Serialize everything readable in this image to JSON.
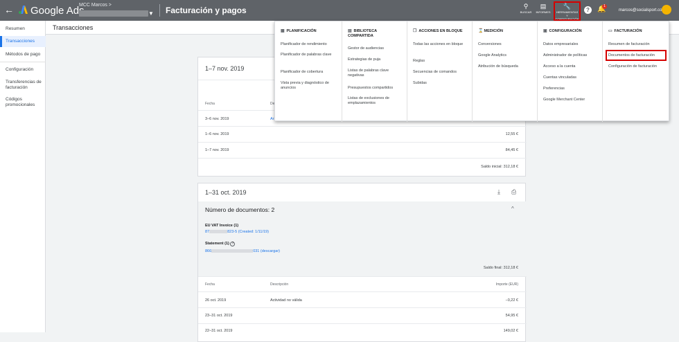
{
  "topbar": {
    "back_icon": "arrow-left",
    "brand": "Google Ads",
    "account_label": "MCC Marcos  >",
    "page_title": "Facturación y pagos",
    "search_label": "BUSCAR",
    "reports_label": "INFORMES",
    "tools_label": "HERRAMIENTAS Y CONFIGURACIÓN",
    "help_icon": "?",
    "notification_count": "1",
    "email": "marcos@socialsport.com"
  },
  "sidebar": {
    "items": [
      {
        "label": "Resumen"
      },
      {
        "label": "Transacciones"
      },
      {
        "label": "Métodos de pago"
      },
      {
        "label": "Configuración"
      },
      {
        "label": "Transferencias de facturación"
      },
      {
        "label": "Códigos promocionales"
      }
    ]
  },
  "subheader": {
    "title": "Transacciones"
  },
  "card1": {
    "title": "1–7 nov. 2019",
    "col_date": "Fecha",
    "col_desc": "De",
    "rows": [
      {
        "date": "3–6 nov. 2019",
        "desc": "Ar",
        "amount": ""
      },
      {
        "date": "1–6 nov. 2019",
        "desc": "",
        "amount": "12,55 €"
      },
      {
        "date": "1–7 nov. 2019",
        "desc": "",
        "amount": "84,45 €"
      }
    ],
    "footer": "Saldo inicial: 312,18 €"
  },
  "card2": {
    "title": "1–31 oct. 2019",
    "doc_count": "Número de documentos: 2",
    "invoice_title": "EU VAT Invoice (1)",
    "invoice_prefix": "87",
    "invoice_suffix": "823-5 (Created: 1/11/19)",
    "statement_title": "Statement (1)",
    "statement_prefix": "866",
    "statement_suffix": "031 (descargar)",
    "final_balance": "Saldo final: 312,18 €",
    "col_date": "Fecha",
    "col_desc": "Descripción",
    "col_amount": "Importe (EUR)",
    "rows": [
      {
        "date": "26 oct. 2019",
        "desc": "Actividad no válida",
        "amount": "−0,22 €"
      },
      {
        "date": "23–31 oct. 2019",
        "desc": "",
        "amount": "54,95 €"
      },
      {
        "date": "22–31 oct. 2019",
        "desc": "",
        "amount": "149,02 €"
      }
    ]
  },
  "menu": {
    "columns": [
      {
        "header": "PLANIFICACIÓN",
        "icon": "calendar-icon",
        "items": [
          "Planificador de rendimiento",
          "Planificador de palabras clave",
          "Planificador de cobertura",
          "Vista previa y diagnóstico de anuncios"
        ]
      },
      {
        "header": "BIBLIOTECA COMPARTIDA",
        "icon": "library-icon",
        "items": [
          "Gestor de audiencias",
          "Estrategias de puja",
          "Listas de palabras clave negativas",
          "Presupuestos compartidos",
          "Listas de exclusiones de emplazamientos"
        ]
      },
      {
        "header": "ACCIONES EN BLOQUE",
        "icon": "copy-icon",
        "items": [
          "Todas las acciones en bloque",
          "Reglas",
          "Secuencias de comandos",
          "Subidas"
        ]
      },
      {
        "header": "MEDICIÓN",
        "icon": "hourglass-icon",
        "items": [
          "Conversiones",
          "Google Analytics",
          "Atribución de búsqueda"
        ]
      },
      {
        "header": "CONFIGURACIÓN",
        "icon": "settings-icon",
        "items": [
          "Datos empresariales",
          "Administrador de políticas",
          "Acceso a la cuenta",
          "Cuentas vinculadas",
          "Preferencias",
          "Google Merchant Center"
        ]
      },
      {
        "header": "FACTURACIÓN",
        "icon": "card-icon",
        "items": [
          "Resumen de facturación",
          "Documentos de facturación",
          "Configuración de facturación"
        ]
      }
    ]
  },
  "colors": {
    "accent": "#1a73e8",
    "highlight": "#d50000",
    "topbar": "#5f6368"
  }
}
